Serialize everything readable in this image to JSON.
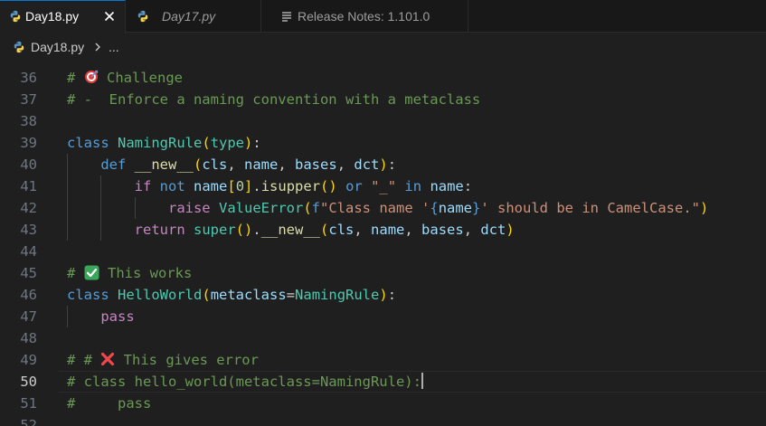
{
  "colors": {
    "background": "#1f1f1f",
    "tab_bar_background": "#181818",
    "active_tab_accent": "#0078d4",
    "python_icon_blue": "#5996c2",
    "python_icon_yellow": "#f5d34f",
    "comment": "#6a9955",
    "keyword": "#569cd6",
    "control_keyword": "#c586c0",
    "class_name": "#4ec9b0",
    "function": "#dcdcaa",
    "variable": "#9cdcfe",
    "string": "#ce9178",
    "number": "#b5cea8",
    "bracket_level1": "#ffd700",
    "bracket_level2": "#da70d6",
    "bracket_level3": "#179fff"
  },
  "tabs": [
    {
      "label": "Day18.py",
      "icon": "python-file-icon",
      "active": true,
      "italic": false,
      "close": "close-icon"
    },
    {
      "label": "Day17.py",
      "icon": "python-file-icon",
      "active": false,
      "italic": true
    },
    {
      "label": "Release Notes: 1.101.0",
      "icon": "document-lines-icon",
      "active": false,
      "italic": false
    }
  ],
  "breadcrumb": {
    "file": "Day18.py",
    "separator_icon": "chevron-right-icon",
    "more": "..."
  },
  "editor": {
    "current_line": 50,
    "lines": [
      {
        "n": "36",
        "tokens": [
          [
            "cm",
            "# "
          ],
          [
            "emoji-target",
            "🎯"
          ],
          [
            "cm",
            " Challenge"
          ]
        ]
      },
      {
        "n": "37",
        "tokens": [
          [
            "cm",
            "# -  Enforce a naming convention with a metaclass"
          ]
        ]
      },
      {
        "n": "38",
        "tokens": []
      },
      {
        "n": "39",
        "tokens": [
          [
            "kw",
            "class"
          ],
          [
            "def",
            " "
          ],
          [
            "cls",
            "NamingRule"
          ],
          [
            "p1",
            "("
          ],
          [
            "cls",
            "type"
          ],
          [
            "p1",
            ")"
          ],
          [
            "def",
            ":"
          ]
        ]
      },
      {
        "n": "40",
        "tokens": [
          [
            "def",
            "    "
          ],
          [
            "kw",
            "def"
          ],
          [
            "def",
            " "
          ],
          [
            "fn",
            "__new__"
          ],
          [
            "p1",
            "("
          ],
          [
            "var",
            "cls"
          ],
          [
            "def",
            ", "
          ],
          [
            "var",
            "name"
          ],
          [
            "def",
            ", "
          ],
          [
            "var",
            "bases"
          ],
          [
            "def",
            ", "
          ],
          [
            "var",
            "dct"
          ],
          [
            "p1",
            ")"
          ],
          [
            "def",
            ":"
          ]
        ]
      },
      {
        "n": "41",
        "tokens": [
          [
            "def",
            "        "
          ],
          [
            "cf",
            "if"
          ],
          [
            "def",
            " "
          ],
          [
            "kw",
            "not"
          ],
          [
            "def",
            " "
          ],
          [
            "var",
            "name"
          ],
          [
            "p1",
            "["
          ],
          [
            "num",
            "0"
          ],
          [
            "p1",
            "]"
          ],
          [
            "def",
            "."
          ],
          [
            "fn",
            "isupper"
          ],
          [
            "p1",
            "()"
          ],
          [
            "def",
            " "
          ],
          [
            "kw",
            "or"
          ],
          [
            "def",
            " "
          ],
          [
            "str",
            "\"_\""
          ],
          [
            "def",
            " "
          ],
          [
            "kw",
            "in"
          ],
          [
            "def",
            " "
          ],
          [
            "var",
            "name"
          ],
          [
            "def",
            ":"
          ]
        ]
      },
      {
        "n": "42",
        "tokens": [
          [
            "def",
            "            "
          ],
          [
            "cf",
            "raise"
          ],
          [
            "def",
            " "
          ],
          [
            "cls",
            "ValueError"
          ],
          [
            "p1",
            "("
          ],
          [
            "kw",
            "f"
          ],
          [
            "str",
            "\"Class name '"
          ],
          [
            "esc",
            "{"
          ],
          [
            "var",
            "name"
          ],
          [
            "esc",
            "}"
          ],
          [
            "str",
            "' should be in CamelCase.\""
          ],
          [
            "p1",
            ")"
          ]
        ]
      },
      {
        "n": "43",
        "tokens": [
          [
            "def",
            "        "
          ],
          [
            "cf",
            "return"
          ],
          [
            "def",
            " "
          ],
          [
            "cls",
            "super"
          ],
          [
            "p1",
            "()"
          ],
          [
            "def",
            "."
          ],
          [
            "fn",
            "__new__"
          ],
          [
            "p1",
            "("
          ],
          [
            "var",
            "cls"
          ],
          [
            "def",
            ", "
          ],
          [
            "var",
            "name"
          ],
          [
            "def",
            ", "
          ],
          [
            "var",
            "bases"
          ],
          [
            "def",
            ", "
          ],
          [
            "var",
            "dct"
          ],
          [
            "p1",
            ")"
          ]
        ]
      },
      {
        "n": "44",
        "tokens": []
      },
      {
        "n": "45",
        "tokens": [
          [
            "cm",
            "# "
          ],
          [
            "emoji-check",
            "✅"
          ],
          [
            "cm",
            " This works"
          ]
        ]
      },
      {
        "n": "46",
        "tokens": [
          [
            "kw",
            "class"
          ],
          [
            "def",
            " "
          ],
          [
            "cls",
            "HelloWorld"
          ],
          [
            "p1",
            "("
          ],
          [
            "var",
            "metaclass"
          ],
          [
            "def",
            "="
          ],
          [
            "cls",
            "NamingRule"
          ],
          [
            "p1",
            ")"
          ],
          [
            "def",
            ":"
          ]
        ]
      },
      {
        "n": "47",
        "tokens": [
          [
            "def",
            "    "
          ],
          [
            "cf",
            "pass"
          ]
        ]
      },
      {
        "n": "48",
        "tokens": []
      },
      {
        "n": "49",
        "tokens": [
          [
            "cm",
            "# # "
          ],
          [
            "emoji-cross",
            "❌"
          ],
          [
            "cm",
            " This gives error"
          ]
        ]
      },
      {
        "n": "50",
        "tokens": [
          [
            "cm",
            "# class hello_world(metaclass=NamingRule):"
          ],
          [
            "cursor",
            ""
          ]
        ]
      },
      {
        "n": "51",
        "tokens": [
          [
            "cm",
            "#     pass"
          ]
        ]
      },
      {
        "n": "52",
        "tokens": []
      }
    ]
  }
}
